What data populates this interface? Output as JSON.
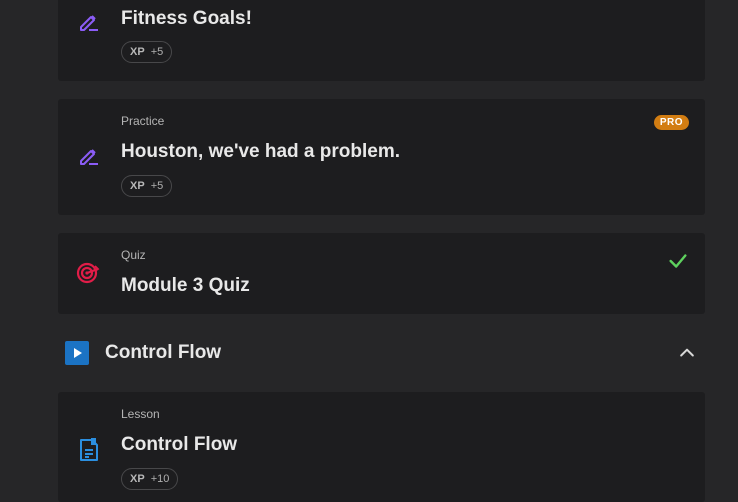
{
  "cards": [
    {
      "title": "Fitness Goals!",
      "xp_label": "XP",
      "xp_value": "+5"
    },
    {
      "kind": "Practice",
      "title": "Houston, we've had a problem.",
      "badge": "PRO",
      "xp_label": "XP",
      "xp_value": "+5"
    },
    {
      "kind": "Quiz",
      "title": "Module 3 Quiz"
    },
    {
      "kind": "Lesson",
      "title": "Control Flow",
      "xp_label": "XP",
      "xp_value": "+10"
    }
  ],
  "section": {
    "title": "Control Flow"
  },
  "colors": {
    "practice_icon": "#8b5cf6",
    "quiz_icon": "#e11d48",
    "lesson_icon": "#2b8fe0",
    "check": "#5ed15e",
    "pro_badge": "#d27d12",
    "section_icon": "#1b73c4"
  },
  "icons": [
    "edit-note-icon",
    "edit-note-icon",
    "target-icon",
    "checkmark-icon",
    "play-icon",
    "chevron-up-icon",
    "document-icon"
  ]
}
